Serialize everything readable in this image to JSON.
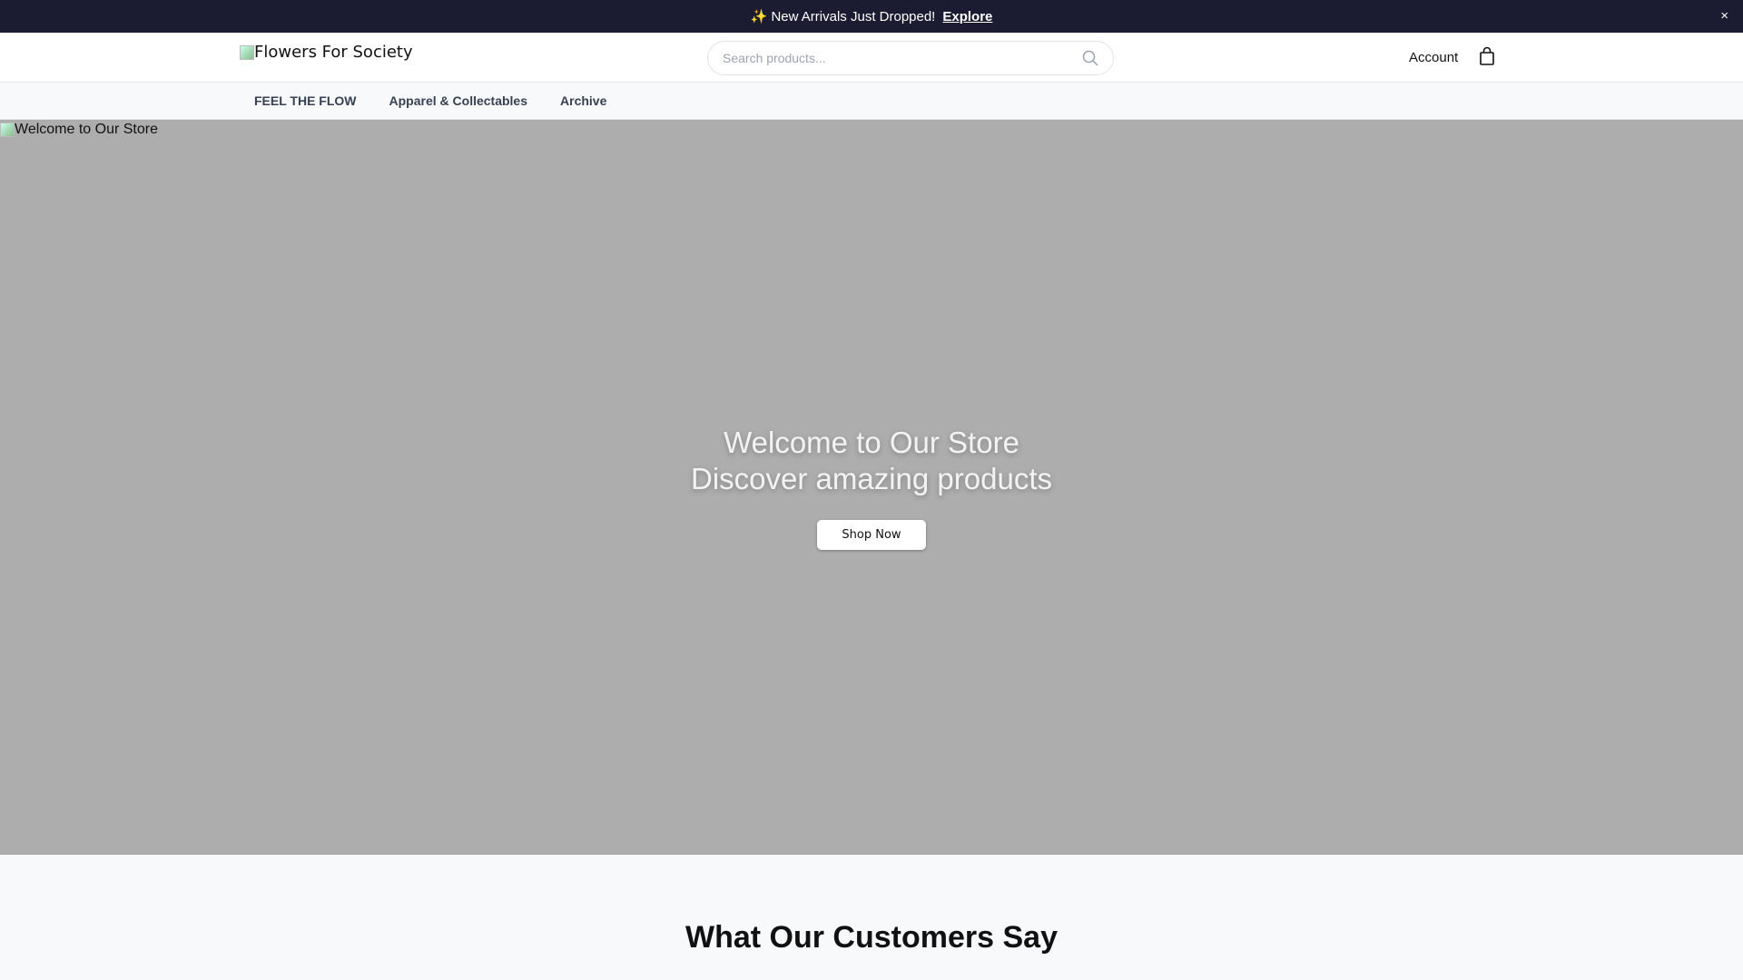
{
  "announcement": {
    "text": "✨ New Arrivals Just Dropped!",
    "link": "Explore",
    "close": "×"
  },
  "header": {
    "logo_alt": "Flowers For Society",
    "search_placeholder": "Search products...",
    "account": "Account"
  },
  "nav": {
    "items": [
      "FEEL THE FLOW",
      "Apparel & Collectables",
      "Archive"
    ]
  },
  "hero": {
    "image_alt": "Welcome to Our Store",
    "title": "Welcome to Our Store",
    "subtitle": "Discover amazing products",
    "button": "Shop Now"
  },
  "testimonials": {
    "heading": "What Our Customers Say"
  }
}
